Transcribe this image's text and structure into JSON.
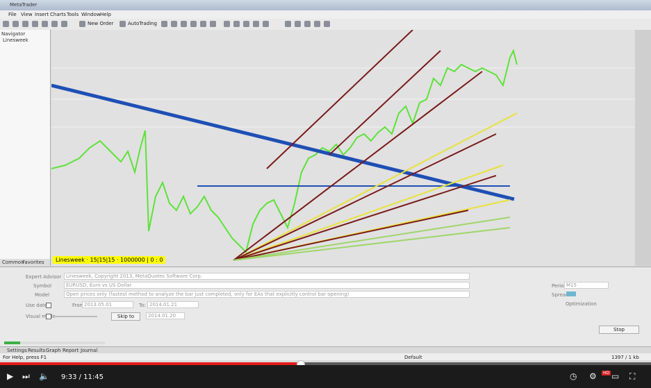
{
  "window": {
    "title": "MetaTrader"
  },
  "menu": [
    "File",
    "View",
    "Insert",
    "Charts",
    "Tools",
    "Window",
    "Help"
  ],
  "toolbar": {
    "new_order": "New Order",
    "autotrading": "AutoTrading"
  },
  "navigator": {
    "title": "Navigator",
    "node": "Linesweek",
    "tabs": [
      "Common",
      "Favorites"
    ]
  },
  "chart": {
    "legend": "Linesweek · 15|15|15 · 1000000 | 0 : 0",
    "colors": {
      "price": "#5ee23a",
      "trend_blue": "#1f4fb5",
      "fan_yellow": "#e8e23a",
      "fan_red": "#7a1a1a",
      "fan_green": "#9fd66a",
      "legend_bg": "#ffff00"
    }
  },
  "tester": {
    "expert_label": "Expert Advisor",
    "expert_value": "Linesweek, Copyright 2013, MetaQuotes Software Corp.",
    "symbol_label": "Symbol",
    "symbol_value": "EURUSD, Euro vs US Dollar",
    "model_label": "Model",
    "model_value": "Open prices only (fastest method to analyze the bar just completed, only for EAs that explicitly control bar opening)",
    "use_date": "Use date",
    "from_label": "From:",
    "from_value": "2013.05.01",
    "to_label": "To:",
    "to_value": "2014.01.21",
    "visual_mode": "Visual mode",
    "skip_to": "Skip to",
    "skip_date": "2014.01.20",
    "period_label": "Period",
    "period_value": "M15",
    "spread_label": "Spread",
    "optimization": "Optimization",
    "start": "Stop",
    "progress": 0.16
  },
  "bottom_tabs": [
    "Settings",
    "Results",
    "Graph",
    "Report",
    "Journal"
  ],
  "status": {
    "left": "For Help, press F1",
    "center": "Default",
    "right": "1397 / 1 kb"
  },
  "video": {
    "time": "9:33 / 11:45",
    "played": 0.46,
    "hd": "HD"
  }
}
